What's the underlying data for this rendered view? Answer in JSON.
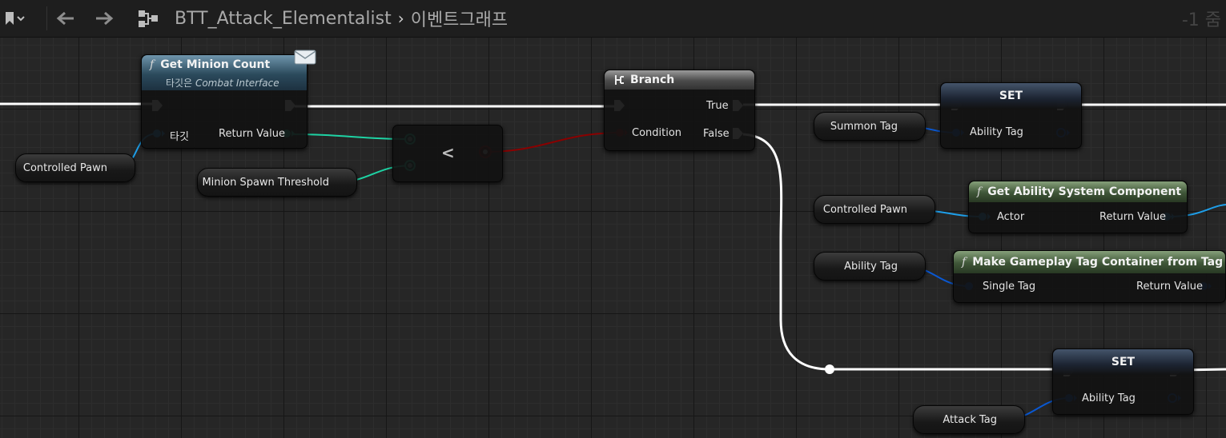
{
  "toolbar": {
    "bookmark_icon": "bookmark-icon",
    "back_icon": "arrow-left-icon",
    "forward_icon": "arrow-right-icon",
    "graph_icon": "blueprint-graph-icon",
    "breadcrumb": [
      "BTT_Attack_Elementalist",
      "이벤트그래프"
    ],
    "chevron": "›",
    "zoom": "-1 줌"
  },
  "nodes": {
    "get_minion_count": {
      "title": "Get Minion Count",
      "subtitle_prefix": "타깃은",
      "subtitle_target": "Combat Interface",
      "target_label": "타깃",
      "return_label": "Return Value"
    },
    "compare": {
      "symbol": "<"
    },
    "branch": {
      "title": "Branch",
      "true_label": "True",
      "condition_label": "Condition",
      "false_label": "False"
    },
    "set_top": {
      "title": "SET",
      "pin_label": "Ability Tag"
    },
    "get_asc": {
      "title": "Get Ability System Component",
      "actor_label": "Actor",
      "return_label": "Return Value"
    },
    "make_tag_container": {
      "title": "Make Gameplay Tag Container from Tag",
      "single_label": "Single Tag",
      "return_label": "Return Value"
    },
    "set_bottom": {
      "title": "SET",
      "pin_label": "Ability Tag"
    }
  },
  "variables": {
    "controlled_pawn_left": "Controlled Pawn",
    "minion_spawn_threshold": "Minion Spawn Threshold",
    "summon_tag": "Summon Tag",
    "controlled_pawn_right": "Controlled Pawn",
    "ability_tag": "Ability Tag",
    "attack_tag": "Attack Tag"
  },
  "colors": {
    "object_pin": "#1e9ee8",
    "struct_pin": "#0a58d2",
    "int_pin": "#1ed3a4",
    "bool_pin": "#8a0000",
    "exec": "#ffffff"
  }
}
